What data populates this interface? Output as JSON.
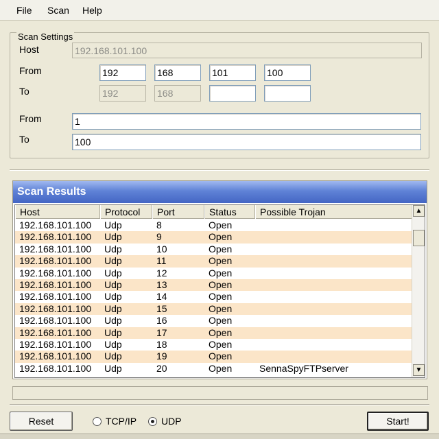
{
  "menu": {
    "items": [
      {
        "label": "File"
      },
      {
        "label": "Scan"
      },
      {
        "label": "Help"
      }
    ]
  },
  "scan_settings": {
    "group_title": "Scan Settings",
    "host_label": "Host",
    "host_value": "192.168.101.100",
    "ip_from_label": "From",
    "ip_to_label": "To",
    "ip_from": [
      "192",
      "168",
      "101",
      "100"
    ],
    "ip_to": [
      "192",
      "168",
      "",
      ""
    ],
    "port_from_label": "From",
    "port_to_label": "To",
    "port_from": "1",
    "port_to": "100"
  },
  "results": {
    "title": "Scan Results",
    "columns": [
      "Host",
      "Protocol",
      "Port",
      "Status",
      "Possible Trojan"
    ],
    "rows": [
      [
        "192.168.101.100",
        "Udp",
        "8",
        "Open",
        ""
      ],
      [
        "192.168.101.100",
        "Udp",
        "9",
        "Open",
        ""
      ],
      [
        "192.168.101.100",
        "Udp",
        "10",
        "Open",
        ""
      ],
      [
        "192.168.101.100",
        "Udp",
        "11",
        "Open",
        ""
      ],
      [
        "192.168.101.100",
        "Udp",
        "12",
        "Open",
        ""
      ],
      [
        "192.168.101.100",
        "Udp",
        "13",
        "Open",
        ""
      ],
      [
        "192.168.101.100",
        "Udp",
        "14",
        "Open",
        ""
      ],
      [
        "192.168.101.100",
        "Udp",
        "15",
        "Open",
        ""
      ],
      [
        "192.168.101.100",
        "Udp",
        "16",
        "Open",
        ""
      ],
      [
        "192.168.101.100",
        "Udp",
        "17",
        "Open",
        ""
      ],
      [
        "192.168.101.100",
        "Udp",
        "18",
        "Open",
        ""
      ],
      [
        "192.168.101.100",
        "Udp",
        "19",
        "Open",
        ""
      ],
      [
        "192.168.101.100",
        "Udp",
        "20",
        "Open",
        "SennaSpyFTPserver"
      ]
    ],
    "alt_row_color": "#fbe5c8",
    "header_color": "#4a6cc8"
  },
  "controls": {
    "reset_label": "Reset",
    "start_label": "Start!",
    "protocol_options": [
      {
        "label": "TCP/IP",
        "checked": false
      },
      {
        "label": "UDP",
        "checked": true
      }
    ]
  },
  "icons": {
    "scroll_up": "scroll-up-arrow-icon",
    "scroll_down": "scroll-down-arrow-icon"
  }
}
